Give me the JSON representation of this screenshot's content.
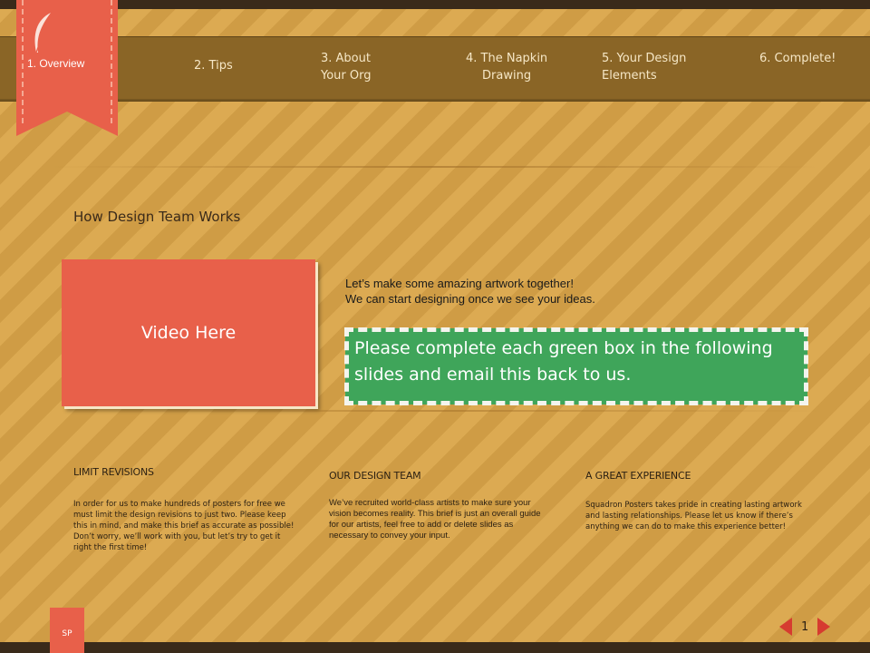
{
  "nav": {
    "items": [
      {
        "label": "1. Overview"
      },
      {
        "label": "2. Tips"
      },
      {
        "label": "3. About\nYour Org"
      },
      {
        "label": "4. The Napkin\nDrawing"
      },
      {
        "label": "5. Your Design\nElements"
      },
      {
        "label": "6. Complete!"
      }
    ]
  },
  "section_title": "How Design Team Works",
  "video_label": "Video Here",
  "intro": {
    "line1": "Let’s make some amazing artwork together!",
    "line2": "We can start designing once we see your ideas."
  },
  "green_box_text": "Please complete each green box in the following slides and email this back to us.",
  "columns": [
    {
      "title": "LIMIT REVISIONS",
      "text": "In order for us to make hundreds of posters for free we must limit the design revisions to just two. Please keep this in mind, and make this brief as accurate as possible! Don’t worry, we’ll work with you, but let’s try to get it right the first time!"
    },
    {
      "title": "OUR DESIGN TEAM",
      "text": "We’ve recruited world-class artists to make sure your vision becomes reality. This brief is just an overall guide for our artists, feel free to add or delete slides as necessary to convey your input."
    },
    {
      "title": "A GREAT EXPERIENCE",
      "text": "Squadron Posters takes pride in creating lasting artwork and lasting relationships. Please let us know if there’s anything we can do to make this experience better!"
    }
  ],
  "sp_tab": "SP",
  "page_number": "1",
  "colors": {
    "accent": "#e8604a",
    "green": "#3fa55a",
    "nav_bg": "#8a6526"
  },
  "icons": {
    "ribbon": "feather-icon",
    "prev": "prev-arrow-icon",
    "next": "next-arrow-icon"
  }
}
